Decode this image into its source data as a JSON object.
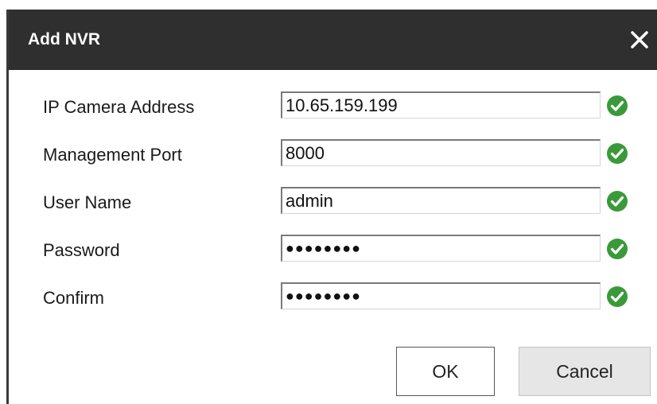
{
  "dialog": {
    "title": "Add NVR",
    "close_icon": "close-icon"
  },
  "form": {
    "rows": [
      {
        "label": "IP Camera Address",
        "value": "10.65.159.199",
        "type": "text",
        "status_icon": "check-circle-icon"
      },
      {
        "label": "Management Port",
        "value": "8000",
        "type": "text",
        "status_icon": "check-circle-icon"
      },
      {
        "label": "User Name",
        "value": "admin",
        "type": "text",
        "status_icon": "check-circle-icon"
      },
      {
        "label": "Password",
        "value": "●●●●●●●●",
        "type": "password",
        "status_icon": "check-circle-icon"
      },
      {
        "label": "Confirm",
        "value": "●●●●●●●●",
        "type": "password",
        "status_icon": "check-circle-icon"
      }
    ]
  },
  "buttons": {
    "ok_label": "OK",
    "cancel_label": "Cancel"
  },
  "colors": {
    "titlebar": "#2f2f2f",
    "check": "#3a9a3a"
  }
}
